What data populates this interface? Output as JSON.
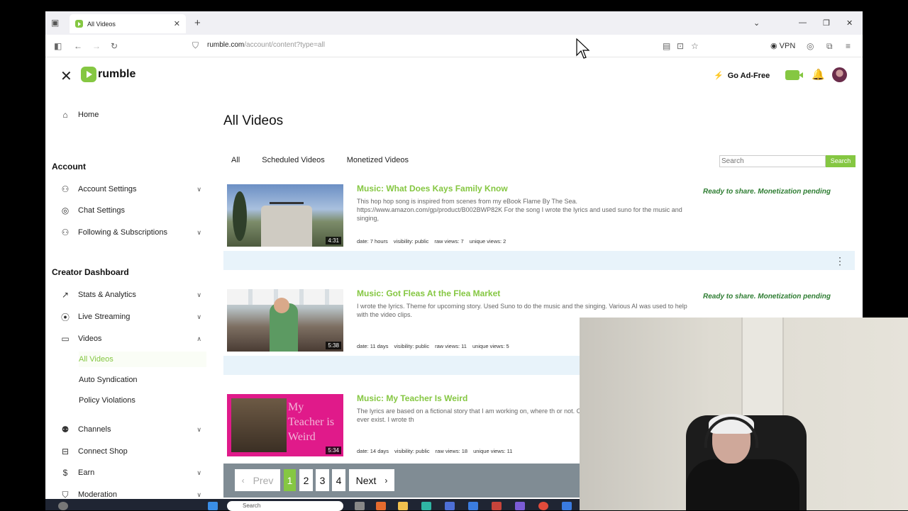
{
  "browser": {
    "tab_title": "All Videos",
    "tab_close": "✕",
    "new_tab": "+",
    "url_host": "rumble.com",
    "url_path": "/account/content?type=all",
    "vpn_label": "VPN"
  },
  "header": {
    "logo_text": "rumble",
    "ad_free": "Go Ad-Free"
  },
  "sidebar": {
    "home": "Home",
    "account_heading": "Account",
    "account_settings": "Account Settings",
    "chat_settings": "Chat Settings",
    "following": "Following & Subscriptions",
    "creator_heading": "Creator Dashboard",
    "stats": "Stats & Analytics",
    "live": "Live Streaming",
    "videos": "Videos",
    "all_videos": "All Videos",
    "auto_syndication": "Auto Syndication",
    "policy_violations": "Policy Violations",
    "channels": "Channels",
    "connect_shop": "Connect Shop",
    "earn": "Earn",
    "moderation": "Moderation"
  },
  "main": {
    "title": "All Videos",
    "filters": [
      "All",
      "Scheduled Videos",
      "Monetized Videos"
    ],
    "search_placeholder": "Search",
    "search_button": "Search",
    "videos": [
      {
        "title": "Music: What Does Kays Family Know",
        "description": "This hop hop song is inspired from scenes from my eBook Flame By The Sea. https://www.amazon.com/gp/product/B002BWP82K For the song I wrote the lyrics and used suno for the music and singing,",
        "duration": "4:31",
        "date": "date: 7 hours",
        "visibility": "visibility: public",
        "raw_views": "raw views: 7",
        "unique_views": "unique views: 2",
        "status": "Ready to share. Monetization pending"
      },
      {
        "title": "Music: Got Fleas At the Flea Market",
        "description": "I wrote the lyrics. Theme for upcoming story. Used Suno to do the music and the singing. Various AI was used to help with the video clips.",
        "duration": "5:38",
        "date": "date: 11 days",
        "visibility": "visibility: public",
        "raw_views": "raw views: 11",
        "unique_views": "unique views: 5",
        "status": "Ready to share. Monetization pending"
      },
      {
        "title": "Music: My Teacher Is Weird",
        "description": "The lyrics are based on a fictional story that I am working on, where th or not. Currently they teach Phaeton did not really ever exist. I wrote th",
        "duration": "5:34",
        "date": "date: 14 days",
        "visibility": "visibility: public",
        "raw_views": "raw views: 18",
        "unique_views": "unique views: 11",
        "thumb_text": "My Teacher is Weird"
      }
    ]
  },
  "pagination": {
    "prev": "Prev",
    "pages": [
      "1",
      "2",
      "3",
      "4"
    ],
    "next": "Next"
  },
  "taskbar": {
    "search": "Search"
  },
  "colors": {
    "brand_green": "#85c742",
    "status_green": "#2e7d32",
    "row_bar": "#e8f3fa"
  }
}
